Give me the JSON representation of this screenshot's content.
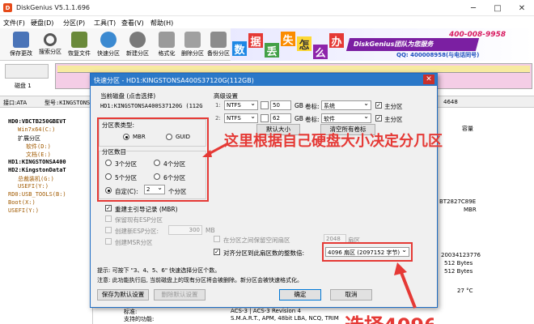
{
  "app": {
    "title": "DiskGenius V5.1.1.696"
  },
  "menu": [
    "文件(F)",
    "硬盘(D)",
    "分区(P)",
    "工具(T)",
    "查看(V)",
    "帮助(H)"
  ],
  "toolbar": [
    "保存更改",
    "搜索分区",
    "恢复文件",
    "快速分区",
    "新建分区",
    "格式化",
    "删除分区",
    "备份分区"
  ],
  "banner": {
    "chars": [
      "数",
      "据",
      "丢",
      "失",
      "怎",
      "么",
      "办"
    ],
    "brand": "DiskGenius团队为您服务",
    "phone": "400-008-9958",
    "qq": "QQ: 400008958(与电话同号)"
  },
  "disk": {
    "label": "磁盘 1",
    "iface_prefix": "接口:ATA",
    "model_prefix": "型号:KINGSTONSA",
    "number": "4648"
  },
  "tree": [
    "HD0:VBCTB250GBEVT",
    "Win7x64(C:)",
    "扩展分区",
    "软件(D:)",
    "文档(E:)",
    "HD1:KINGSTONSA400",
    "HD2:KingstonDataT",
    "总裁装机(G:)",
    "USEFI(Y:)",
    "RD0:USB_TOOLS(B:)",
    "Boot(X:)",
    "USEFI(Y:)"
  ],
  "rightpane": [
    "容量",
    "BT2827C89E",
    "MBR",
    "20034123776",
    "512 Bytes",
    "512 Bytes",
    "27 °C"
  ],
  "bottompane": [
    {
      "k": "标准:",
      "v": "ACS-3 | ACS-3 Revision 4"
    },
    {
      "k": "支持的功能:",
      "v": "S.M.A.R.T., APM, 48bit LBA, NCQ, TRIM"
    }
  ],
  "dialog": {
    "title": "快速分区 - HD1:KINGSTONSA400S37120G(112GB)",
    "current_disk_label": "当前磁盘 (点击选择)",
    "current_disk_value": "HD1:KINGSTONSA400S37120G (112G",
    "ptype_label": "分区表类型:",
    "ptype_options": [
      "MBR",
      "GUID"
    ],
    "count_label": "分区数目",
    "count_options": [
      "3个分区",
      "4个分区",
      "5个分区",
      "6个分区"
    ],
    "custom_label": "自定(C):",
    "custom_value": "2",
    "custom_unit": "个分区",
    "rebuild_mbr": "重建主引导记录 (MBR)",
    "keep_esp": "保留现有ESP分区",
    "create_esp": "创建新ESP分区:",
    "esp_size": "300",
    "esp_unit": "MB",
    "create_msr": "创建MSR分区",
    "advanced_label": "高级设置",
    "partitions": [
      {
        "fs": "NTFS",
        "size": "50",
        "unit": "GB",
        "vol_label": "卷标:",
        "vol": "系统",
        "primary": "主分区"
      },
      {
        "fs": "NTFS",
        "size": "62",
        "unit": "GB",
        "vol_label": "卷标:",
        "vol": "软件",
        "primary": "主分区"
      }
    ],
    "default_size_btn": "默认大小",
    "clear_labels_btn": "清空所有卷标",
    "keep_free": "在分区之间保留空闲扇区",
    "keep_free_value": "2048",
    "keep_free_unit": "扇区",
    "align": "对齐分区到此扇区数的整数倍:",
    "align_value": "4096 扇区 (2097152 字节)",
    "hint": "提示: 可按下 \"3、4、5、6\" 快速选择分区个数。",
    "note": "注意: 此功能执行后, 当前磁盘上的现有分区将会被删除。新分区会被快速格式化。",
    "save_btn": "保存为默认设置",
    "delete_btn": "删除默认设置",
    "ok_btn": "确定",
    "cancel_btn": "取消"
  },
  "annotations": {
    "callout1": "这里根据自己硬盘大小决定分几区",
    "callout2": "选择4096"
  },
  "colors": {
    "accent": "#2b78c8",
    "annotation": "#e53935",
    "disk_bar": "#f4cde6"
  }
}
